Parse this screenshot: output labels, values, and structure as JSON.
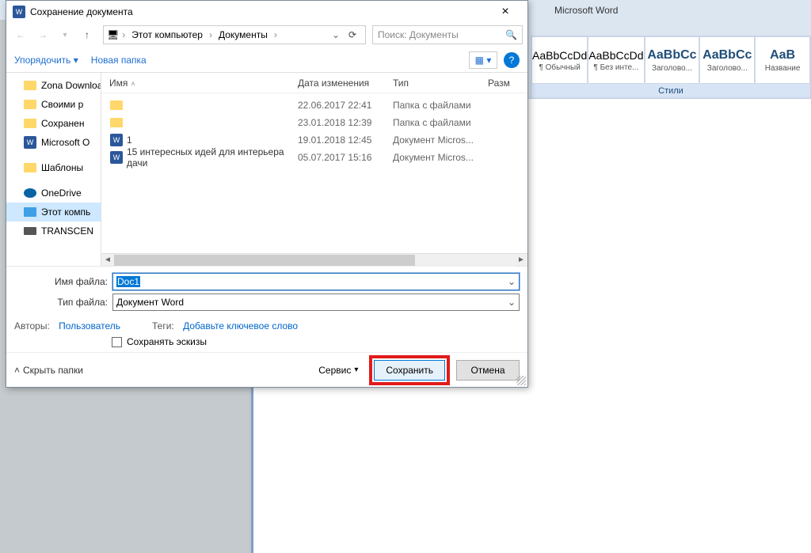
{
  "word": {
    "app_title": "Microsoft Word",
    "styles": [
      {
        "preview": "AaBbCcDd",
        "label": "¶ Обычный",
        "bold": false
      },
      {
        "preview": "AaBbCcDd",
        "label": "¶ Без инте...",
        "bold": false
      },
      {
        "preview": "AaBbCc",
        "label": "Заголово...",
        "bold": true
      },
      {
        "preview": "AaBbCc",
        "label": "Заголово...",
        "bold": true
      },
      {
        "preview": "AaB",
        "label": "Название",
        "bold": true
      }
    ],
    "styles_caption": "Стили"
  },
  "dialog": {
    "title": "Сохранение документа",
    "close": "×",
    "breadcrumb": {
      "pc_icon": "🖥",
      "root": "Этот компьютер",
      "folder": "Документы"
    },
    "search_placeholder": "Поиск: Документы",
    "organize": "Упорядочить",
    "new_folder": "Новая папка",
    "tree": [
      {
        "icon": "folder",
        "label": "Zona Downloads"
      },
      {
        "icon": "folder",
        "label": "Своими р"
      },
      {
        "icon": "folder",
        "label": "Сохранен"
      },
      {
        "icon": "word",
        "label": "Microsoft O"
      },
      {
        "icon": "folder",
        "label": "Шаблоны"
      },
      {
        "icon": "cloud",
        "label": "OneDrive"
      },
      {
        "icon": "monitor",
        "label": "Этот компь",
        "selected": true
      },
      {
        "icon": "disk",
        "label": "TRANSCEN"
      }
    ],
    "columns": {
      "name": "Имя",
      "date": "Дата изменения",
      "type": "Тип",
      "size": "Разм"
    },
    "files": [
      {
        "icon": "folder",
        "name": "",
        "date": "22.06.2017 22:41",
        "type": "Папка с файлами"
      },
      {
        "icon": "folder",
        "name": "",
        "date": "23.01.2018 12:39",
        "type": "Папка с файлами"
      },
      {
        "icon": "word",
        "name": "1",
        "date": "19.01.2018 12:45",
        "type": "Документ Micros..."
      },
      {
        "icon": "word",
        "name": "15 интересных идей для интерьера дачи",
        "date": "05.07.2017 15:16",
        "type": "Документ Micros..."
      }
    ],
    "filename_label": "Имя файла:",
    "filename_value": "Doc1",
    "filetype_label": "Тип файла:",
    "filetype_value": "Документ Word",
    "authors_label": "Авторы:",
    "authors_value": "Пользователь",
    "tags_label": "Теги:",
    "tags_value": "Добавьте ключевое слово",
    "save_thumb": "Сохранять эскизы",
    "hide_folders": "Скрыть папки",
    "service": "Сервис",
    "save": "Сохранить",
    "cancel": "Отмена"
  }
}
